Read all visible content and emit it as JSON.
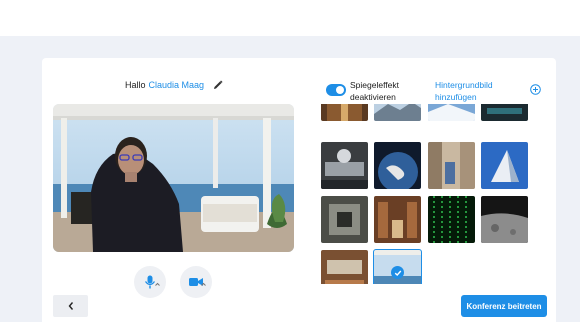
{
  "greeting": {
    "prefix": "Hallo",
    "name": "Claudia Maag"
  },
  "video": {
    "microphone_icon": "microphone-icon",
    "camera_icon": "camera-icon"
  },
  "settings": {
    "mirror_toggle_on": true,
    "mirror_label": "Spiegeleffekt deaktivieren",
    "background_link": "Hintergrundbild hinzufügen",
    "add_icon": "plus-circle-icon"
  },
  "backgrounds": {
    "tiles": [
      {
        "name": "bg-hall-warm"
      },
      {
        "name": "bg-snow-mountains"
      },
      {
        "name": "bg-glacier"
      },
      {
        "name": "bg-dark-room"
      },
      {
        "name": "bg-spaceship-interior"
      },
      {
        "name": "bg-earth-from-space"
      },
      {
        "name": "bg-city-street"
      },
      {
        "name": "bg-matterhorn"
      },
      {
        "name": "bg-space-station"
      },
      {
        "name": "bg-library"
      },
      {
        "name": "bg-matrix-code"
      },
      {
        "name": "bg-moon-surface"
      },
      {
        "name": "bg-lounge-interior"
      },
      {
        "name": "bg-sea-terrace"
      }
    ],
    "selected_index": 13
  },
  "footer": {
    "back_icon": "chevron-left-icon",
    "join_label": "Konferenz beitreten"
  },
  "colors": {
    "accent": "#1e8ee6",
    "page_bg": "#eef1f7"
  }
}
